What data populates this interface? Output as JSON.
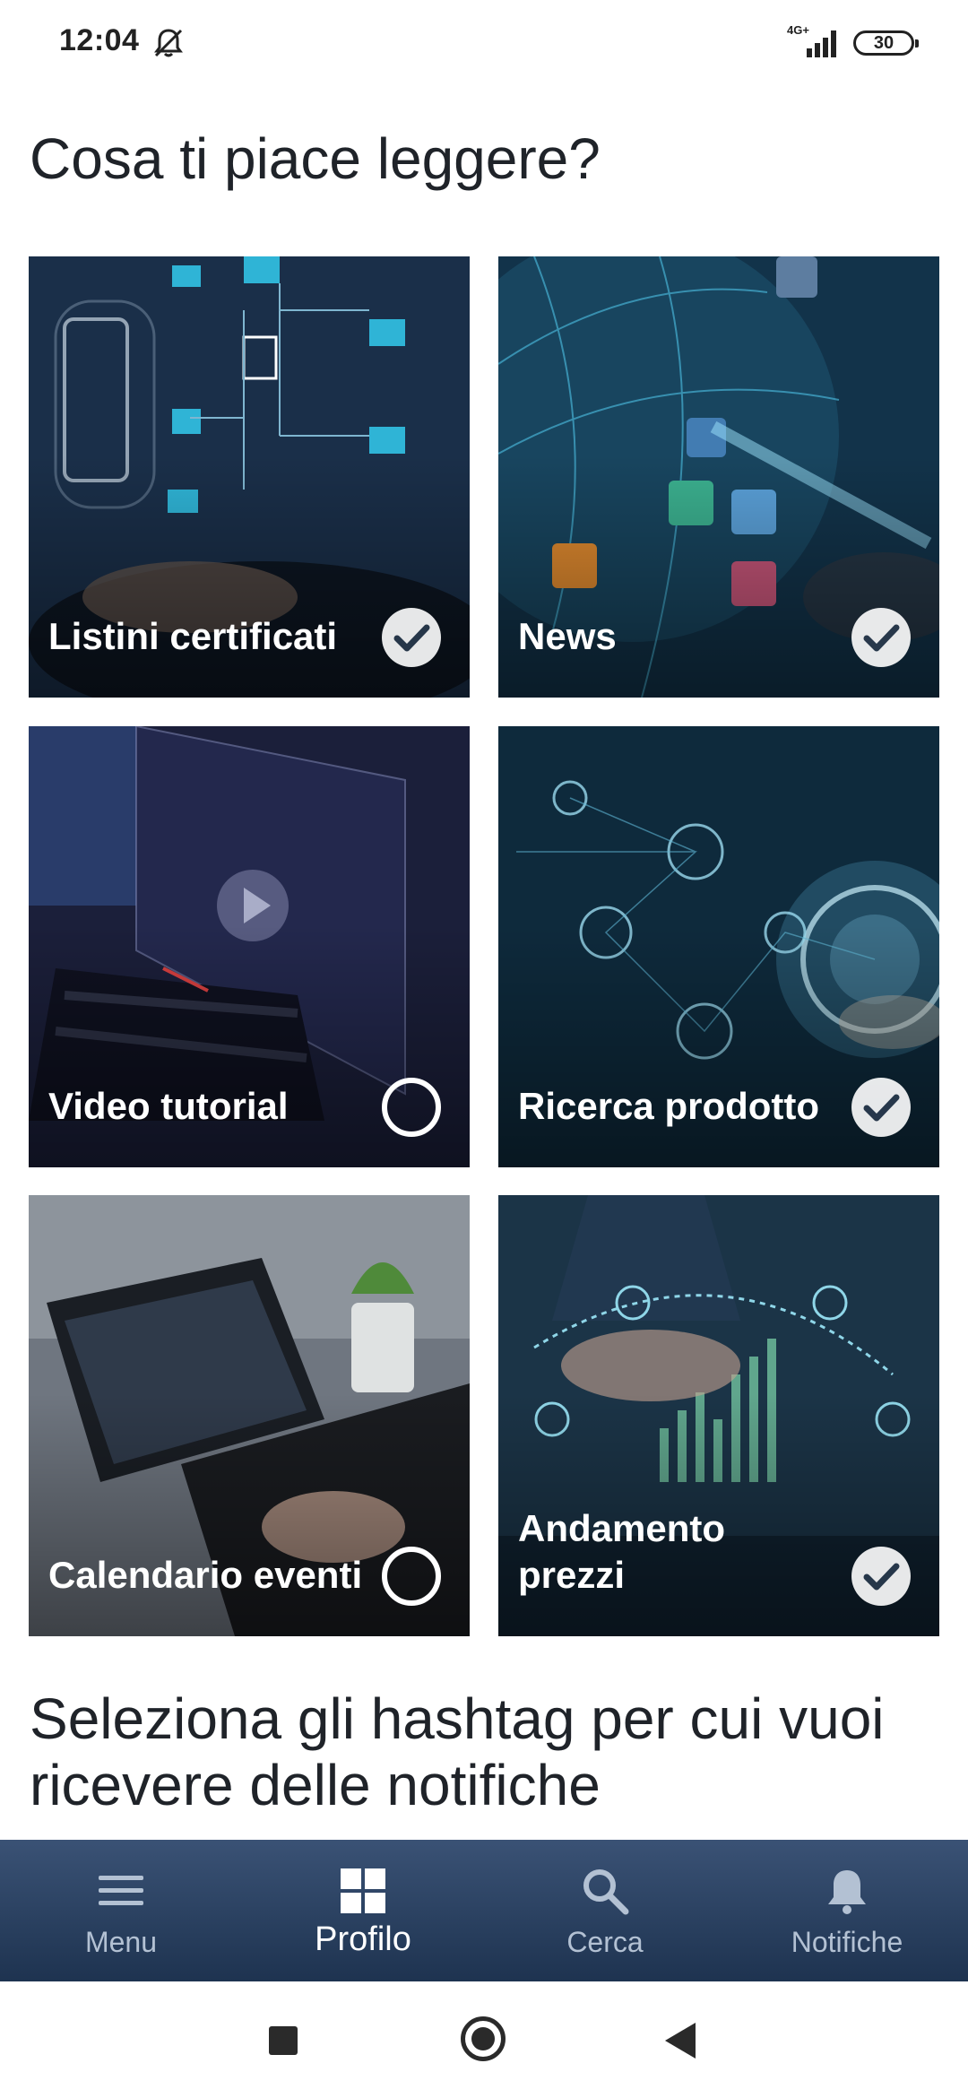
{
  "status_bar": {
    "time": "12:04",
    "network": "4G+",
    "battery": "30"
  },
  "title": "Cosa ti piace leggere?",
  "categories": [
    {
      "label": "Listini certificati",
      "selected": true
    },
    {
      "label": "News",
      "selected": true
    },
    {
      "label": "Video tutorial",
      "selected": false
    },
    {
      "label": "Ricerca prodotto",
      "selected": true
    },
    {
      "label": "Calendario eventi",
      "selected": false
    },
    {
      "label": "Andamento prezzi",
      "selected": true
    }
  ],
  "hashtag_section_title": "Seleziona gli hashtag per cui vuoi ricevere delle notifiche",
  "nav": {
    "items": [
      {
        "label": "Menu",
        "icon": "menu-icon"
      },
      {
        "label": "Profilo",
        "icon": "grid-icon",
        "active": true
      },
      {
        "label": "Cerca",
        "icon": "search-icon"
      },
      {
        "label": "Notifiche",
        "icon": "bell-icon"
      }
    ]
  },
  "colors": {
    "nav_bg": "#2b4262",
    "title": "#1f2329"
  }
}
